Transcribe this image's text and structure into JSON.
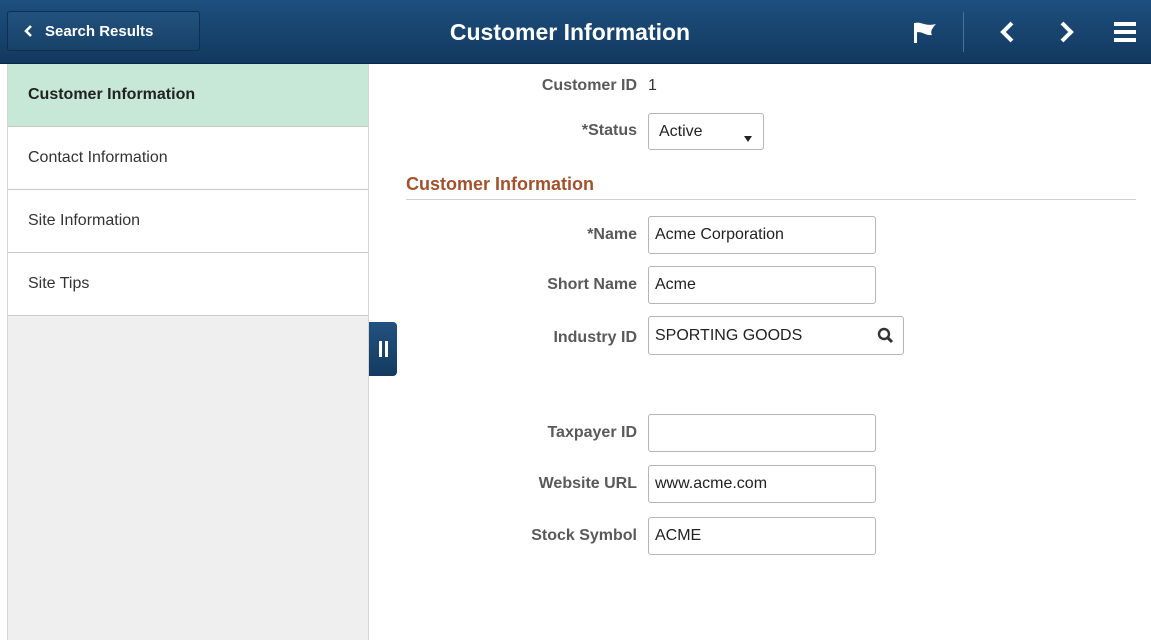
{
  "header": {
    "back_label": "Search Results",
    "title": "Customer Information",
    "icons": [
      "flag-icon",
      "previous-icon",
      "next-icon",
      "menu-icon"
    ]
  },
  "nav": {
    "items": [
      {
        "label": "Customer Information",
        "active": true
      },
      {
        "label": "Contact Information",
        "active": false
      },
      {
        "label": "Site Information",
        "active": false
      },
      {
        "label": "Site Tips",
        "active": false
      }
    ]
  },
  "form": {
    "customer_id": {
      "label": "Customer ID",
      "value": "1"
    },
    "status": {
      "label": "*Status",
      "value": "Active"
    },
    "section_title": "Customer Information",
    "name": {
      "label": "*Name",
      "value": "Acme Corporation"
    },
    "short_name": {
      "label": "Short Name",
      "value": "Acme"
    },
    "industry_id": {
      "label": "Industry ID",
      "value": "SPORTING GOODS"
    },
    "taxpayer_id": {
      "label": "Taxpayer ID",
      "value": ""
    },
    "website_url": {
      "label": "Website URL",
      "value": "www.acme.com"
    },
    "stock_symbol": {
      "label": "Stock Symbol",
      "value": "ACME"
    }
  },
  "colors": {
    "header_bg": "#1b476f",
    "nav_active_bg": "#c7e8d6",
    "section_title": "#a0522d"
  }
}
